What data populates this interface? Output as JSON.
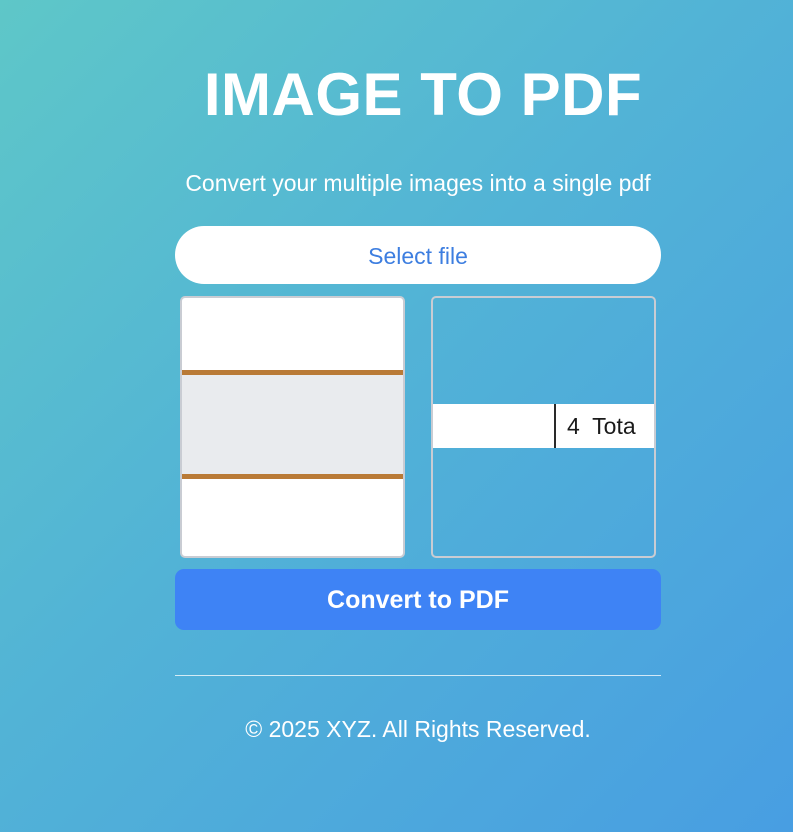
{
  "header": {
    "title": "IMAGE TO PDF",
    "subtitle": "Convert your multiple images into a single pdf"
  },
  "actions": {
    "select_file_label": "Select file",
    "convert_label": "Convert to PDF"
  },
  "previews": [
    {
      "name": "image-preview-1"
    },
    {
      "name": "image-preview-2",
      "visible_text": "4  Tota"
    }
  ],
  "footer": {
    "copyright": "© 2025 XYZ. All Rights Reserved."
  },
  "colors": {
    "background_start": "#5ec7c8",
    "background_end": "#489ee2",
    "accent_button": "#3e83f5",
    "select_text": "#3d7ee0",
    "preview_rule": "#b97a36"
  }
}
